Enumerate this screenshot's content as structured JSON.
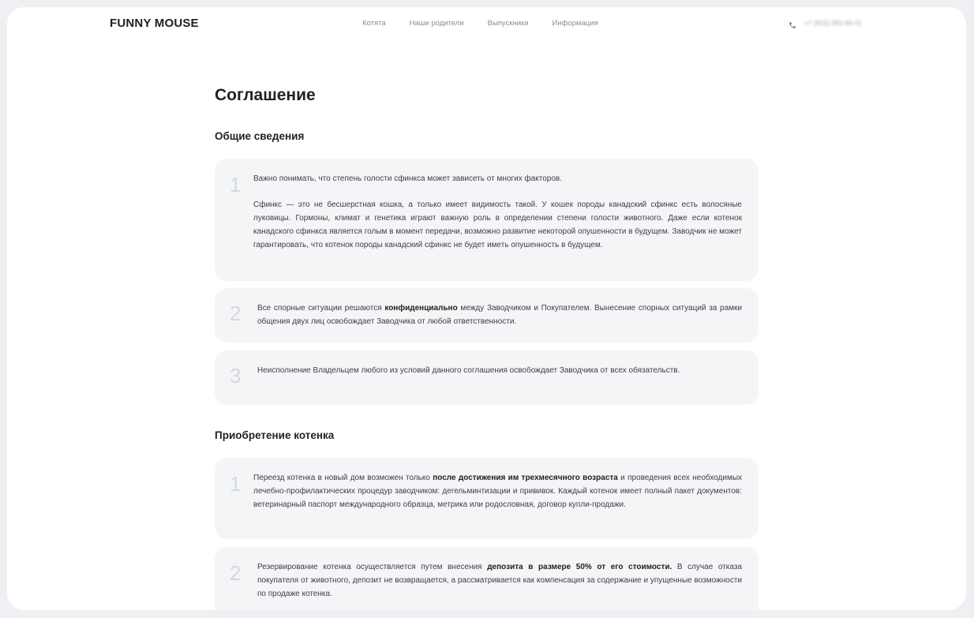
{
  "header": {
    "logo": "FUNNY MOUSE",
    "nav": [
      "Котята",
      "Наши родители",
      "Выпускники",
      "Информация"
    ],
    "phone": "+7 (915) 392-60-31"
  },
  "page_title": "Соглашение",
  "sections": [
    {
      "title": "Общие сведения",
      "items": [
        {
          "number": "1",
          "p1": "Важно понимать, что степень голости сфинкса может зависеть от многих факторов.",
          "p2": "Сфинкс — это не бесшерстная кошка, а только имеет видимость такой. У кошек породы канадский сфинкс есть волосяные луковицы. Гормоны, климат и генетика играют важную роль в определении степени голости животного. Даже если котенок канадского сфинкса является голым в момент передачи, возможно развитие некоторой опушенности в будущем. Заводчик не может гарантировать, что котенок породы канадский сфинкс не будет иметь опушенность в будущем."
        },
        {
          "number": "2",
          "pre": "Все спорные ситуации решаются ",
          "bold": "конфиденциально",
          "post": " между Заводчиком и Покупателем. Вынесение спорных ситуаций за рамки общения двух лиц освобождает Заводчика от любой ответственности."
        },
        {
          "number": "3",
          "text": "Неисполнение Владельцем любого из условий данного соглашения освобождает Заводчика от всех обязательств."
        }
      ]
    },
    {
      "title": "Приобретение котенка",
      "items": [
        {
          "number": "1",
          "pre": "Переезд котенка в новый дом возможен только ",
          "bold": "после достижения им трехмесячного возраста",
          "post": " и проведения всех необходимых лечебно-профилактических процедур заводчиком: дегельминтизации и прививок. Каждый котенок имеет полный пакет документов: ветеринарный паспорт международного образца, метрика или родословная, договор купли-продажи."
        },
        {
          "number": "2",
          "pre": "Резервирование котенка осуществляется путем внесения ",
          "bold": "депозита в размере 50% от его стоимости.",
          "post": " В случае отказа покупателя от животного, депозит не возвращается, а рассматривается как компенсация за содержание и упущенные возможности по продаже котенка."
        }
      ]
    }
  ],
  "icons": {
    "phone": "phone-icon"
  },
  "colors": {
    "card_bg": "#f4f5f7",
    "number": "#d4d7dd",
    "page_bg": "#eef0f4"
  }
}
